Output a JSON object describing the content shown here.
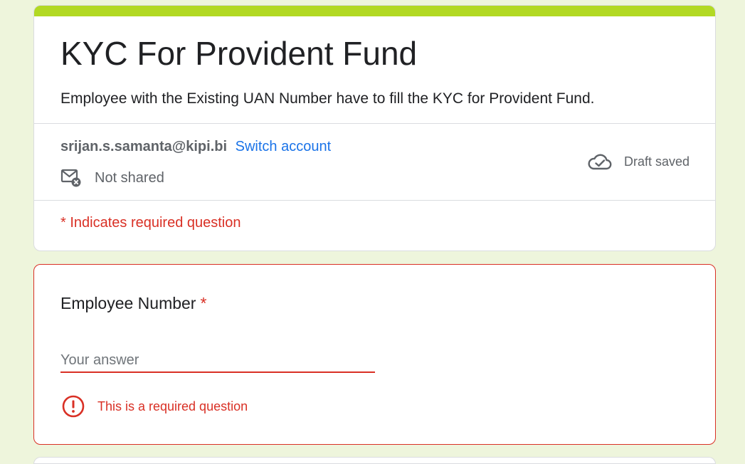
{
  "theme": {
    "accent_color": "#b2d923",
    "background_color": "#eef5dc",
    "error_color": "#d93025",
    "link_color": "#1a73e8"
  },
  "header": {
    "title": "KYC For Provident Fund",
    "description": "Employee with the Existing UAN Number have to fill the KYC for Provident Fund."
  },
  "account": {
    "email": "srijan.s.samanta@kipi.bi",
    "switch_label": "Switch account",
    "shared_status": "Not shared",
    "shared_icon": "mail-not-shared-icon",
    "draft_status": "Draft saved",
    "draft_icon": "cloud-done-icon"
  },
  "required_note": "* Indicates required question",
  "question": {
    "label": "Employee Number",
    "required_marker": "*",
    "value": "",
    "placeholder": "Your answer",
    "error_text": "This is a required question",
    "error_icon": "error-icon"
  }
}
